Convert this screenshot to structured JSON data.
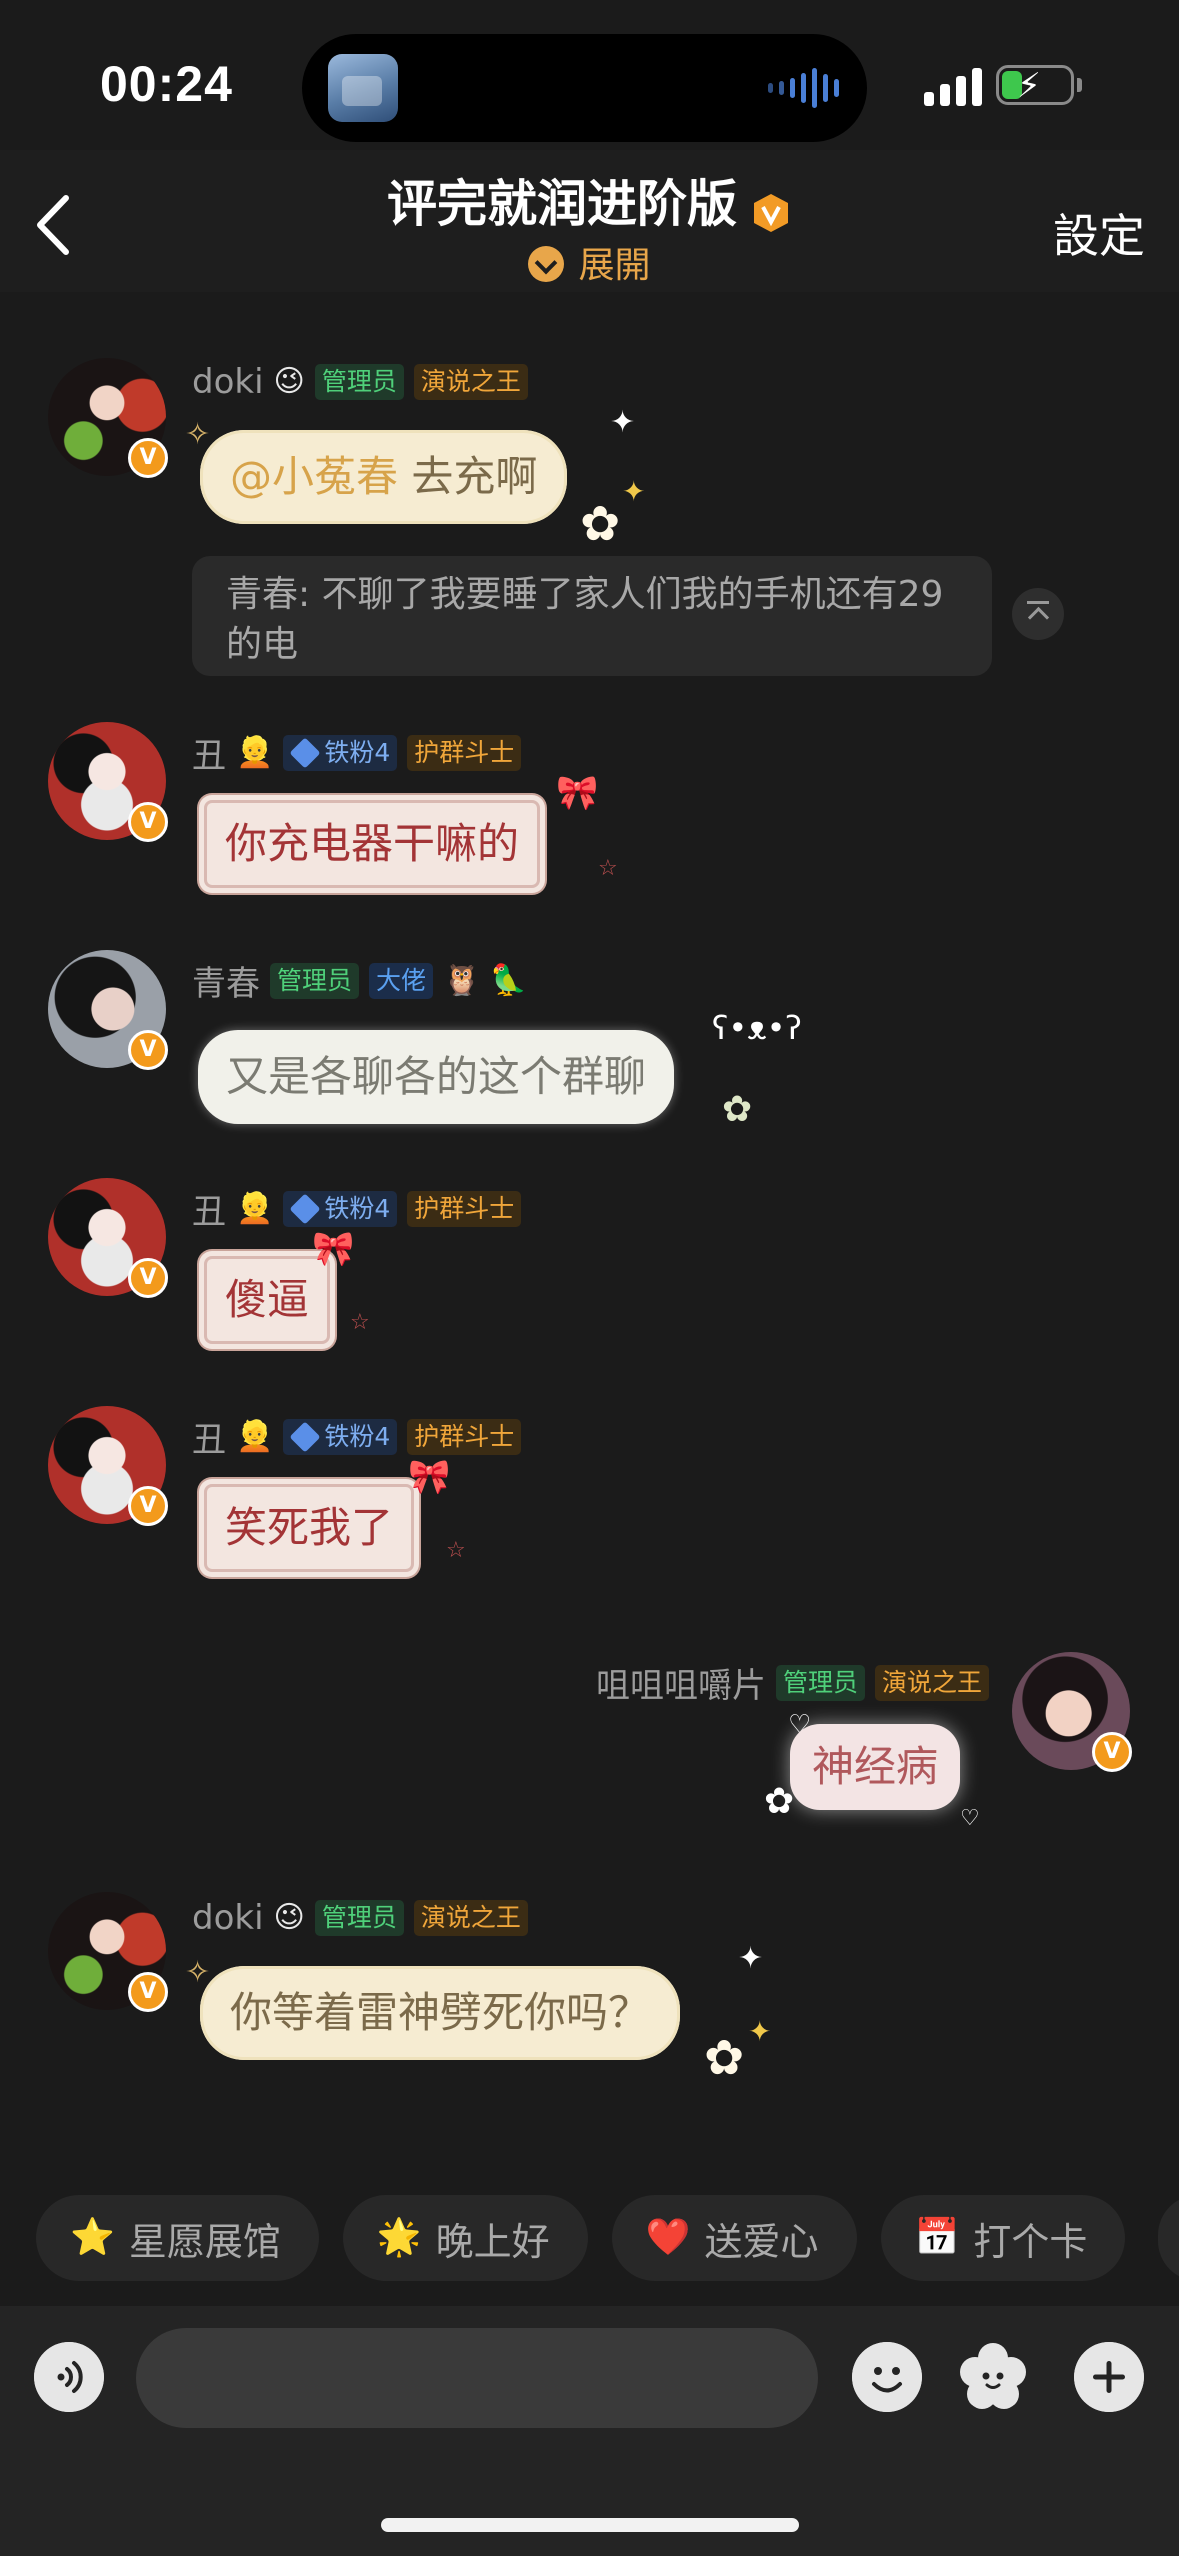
{
  "status_bar": {
    "time": "00:24",
    "signal_bars": 4,
    "battery_level": 0.3,
    "battery_charging": true
  },
  "header": {
    "title": "评完就润进阶版",
    "expand_label": "展開",
    "settings_label": "設定"
  },
  "messages": [
    {
      "sender": "doki",
      "emoji": "😉",
      "tags": [
        "管理员",
        "演说之王"
      ],
      "mention": "@小菟春",
      "text": "去充啊",
      "quote": "青春: 不聊了我要睡了家人们我的手机还有29的电"
    },
    {
      "sender": "丑",
      "emoji": "👱",
      "tags": [
        "铁粉4",
        "护群斗士"
      ],
      "text": "你充电器干嘛的"
    },
    {
      "sender": "青春",
      "tags": [
        "管理员",
        "大佬"
      ],
      "emojis": "🦉 🦜",
      "text": "又是各聊各的这个群聊"
    },
    {
      "sender": "丑",
      "emoji": "👱",
      "tags": [
        "铁粉4",
        "护群斗士"
      ],
      "text": "傻逼"
    },
    {
      "sender": "丑",
      "emoji": "👱",
      "tags": [
        "铁粉4",
        "护群斗士"
      ],
      "text": "笑死我了"
    },
    {
      "sender": "咀咀咀嚼片",
      "tags": [
        "管理员",
        "演说之王"
      ],
      "text": "神经病",
      "self": true
    },
    {
      "sender": "doki",
      "emoji": "😉",
      "tags": [
        "管理员",
        "演说之王"
      ],
      "text": "你等着雷神劈死你吗？"
    }
  ],
  "quick_chips": [
    {
      "icon": "star-icon",
      "glyph": "⭐",
      "label": "星愿展馆"
    },
    {
      "icon": "star-face-icon",
      "glyph": "🌟",
      "label": "晚上好"
    },
    {
      "icon": "heart-icon",
      "glyph": "❤️",
      "label": "送爱心"
    },
    {
      "icon": "calendar-icon",
      "glyph": "📅",
      "label": "打个卡"
    }
  ],
  "colors": {
    "background": "#1b1b1b",
    "accent": "#e8a64a",
    "admin_tag": "#4fd07a",
    "king_tag": "#f0a63a",
    "fan_tag": "#7eaef0"
  }
}
